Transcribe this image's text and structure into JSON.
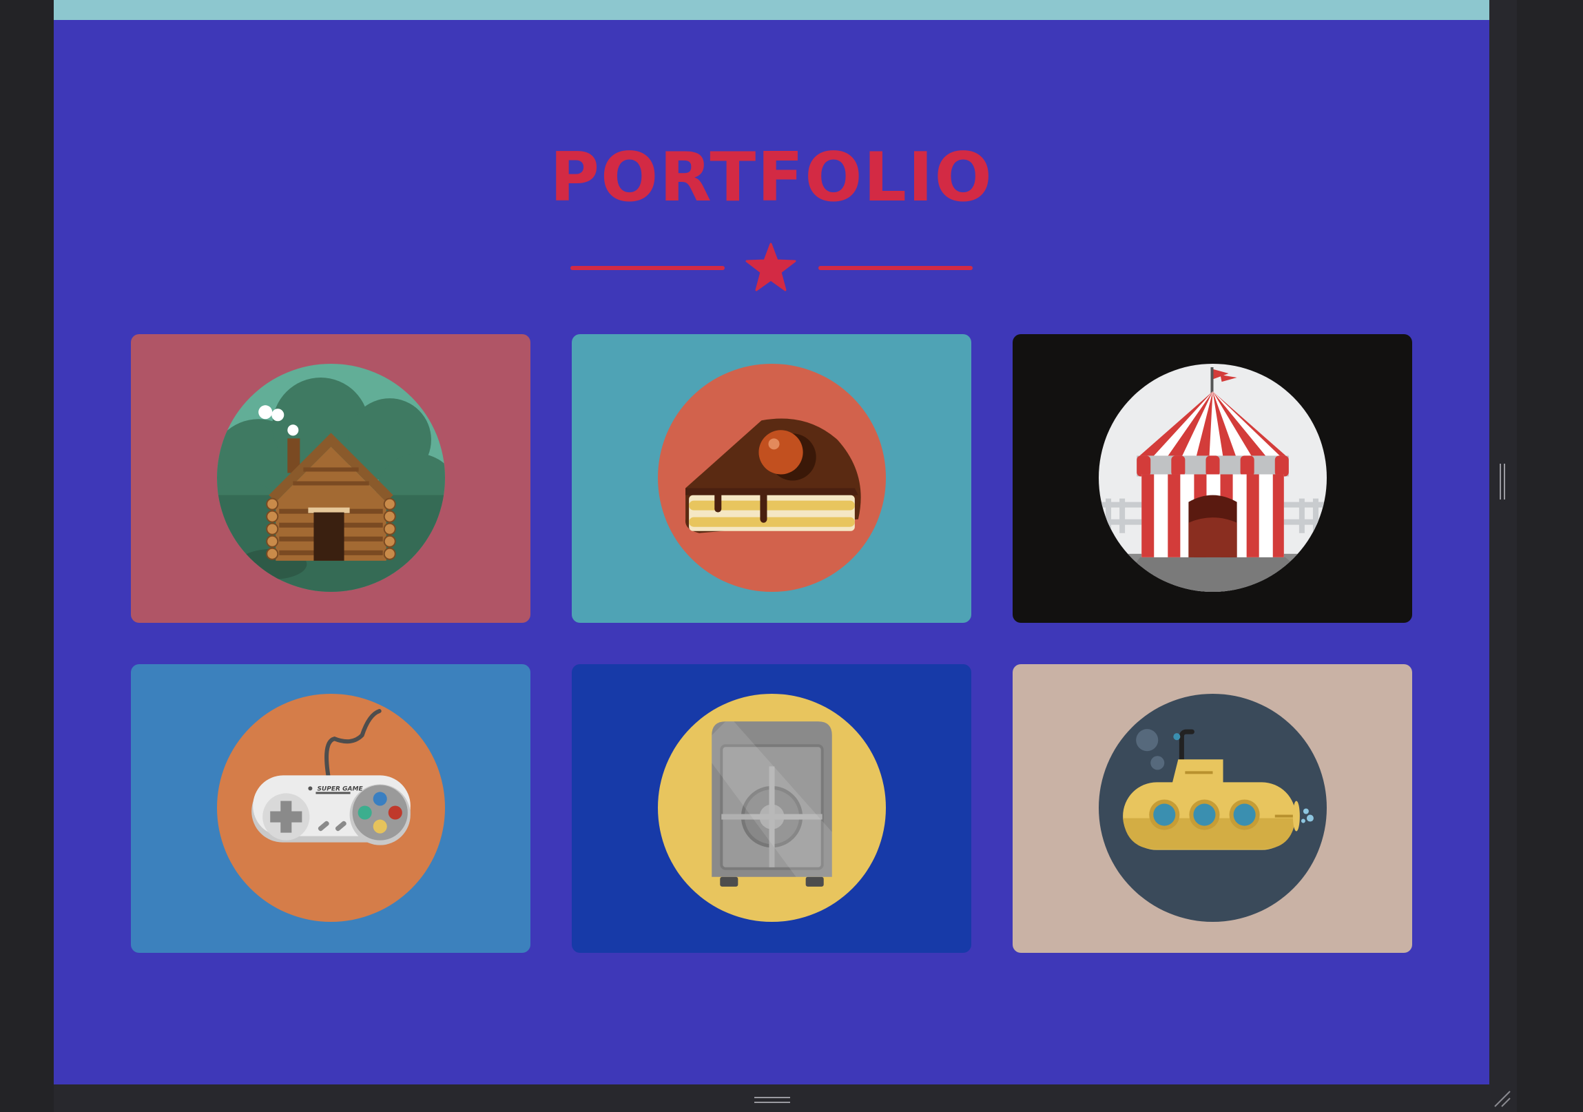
{
  "page": {
    "title": "PORTFOLIO",
    "colors": {
      "background": "#3e38b8",
      "accent": "#d32a44",
      "top_bar": "#8dc7cf",
      "chrome": "#28282d"
    }
  },
  "portfolio": {
    "items": [
      {
        "icon": "log-cabin-icon",
        "background": "#b05566"
      },
      {
        "icon": "cake-slice-icon",
        "background": "#4fa3b5"
      },
      {
        "icon": "circus-tent-icon",
        "background": "#121110"
      },
      {
        "icon": "game-controller-icon",
        "background": "#3c81bd",
        "controller_label": "SUPER GAME"
      },
      {
        "icon": "safe-icon",
        "background": "#173aa8"
      },
      {
        "icon": "submarine-icon",
        "background": "#c9b2a5"
      }
    ]
  }
}
